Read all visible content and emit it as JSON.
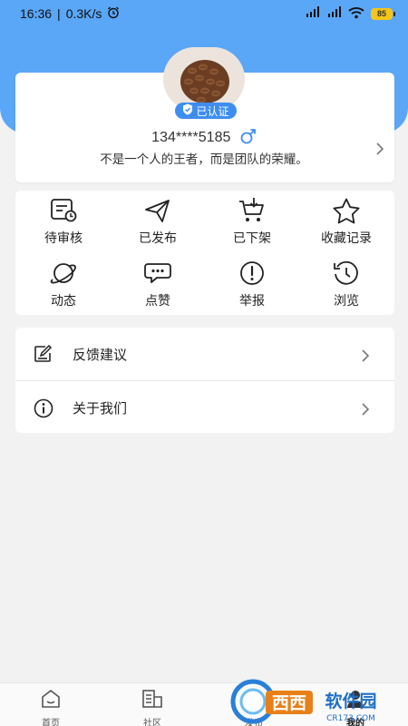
{
  "status_bar": {
    "time": "16:36",
    "separator": "|",
    "network_speed": "0.3K/s",
    "battery_level": "85",
    "battery_color": "#f5c518"
  },
  "theme": {
    "header_color": "#5aa6f7",
    "badge_color": "#3e8ef0",
    "gender_color": "#3e8ef0"
  },
  "profile": {
    "avatar_icon": "coffee-beans-avatar",
    "verified_label": "已认证",
    "phone": "134****5185",
    "gender_icon": "male-icon",
    "motto": "不是一个人的王者，而是团队的荣耀。"
  },
  "grid": {
    "items": [
      {
        "label": "待审核",
        "icon": "pending-review-icon"
      },
      {
        "label": "已发布",
        "icon": "paper-plane-icon"
      },
      {
        "label": "已下架",
        "icon": "cart-download-icon"
      },
      {
        "label": "收藏记录",
        "icon": "star-icon"
      },
      {
        "label": "动态",
        "icon": "planet-icon"
      },
      {
        "label": "点赞",
        "icon": "chat-bubble-icon"
      },
      {
        "label": "举报",
        "icon": "exclamation-icon"
      },
      {
        "label": "浏览",
        "icon": "history-icon"
      }
    ]
  },
  "menu": {
    "items": [
      {
        "label": "反馈建议",
        "icon": "edit-note-icon"
      },
      {
        "label": "关于我们",
        "icon": "info-icon"
      }
    ]
  },
  "bottom_nav": {
    "items": [
      {
        "label": "首页",
        "icon": "home-icon"
      },
      {
        "label": "社区",
        "icon": "community-icon"
      },
      {
        "label": "发布",
        "icon": "publish-icon"
      },
      {
        "label": "我的",
        "icon": "profile-icon"
      }
    ],
    "active_index": 3
  },
  "watermark": {
    "brand_text": "西西软件园",
    "domain_text": "CR173.COM"
  }
}
